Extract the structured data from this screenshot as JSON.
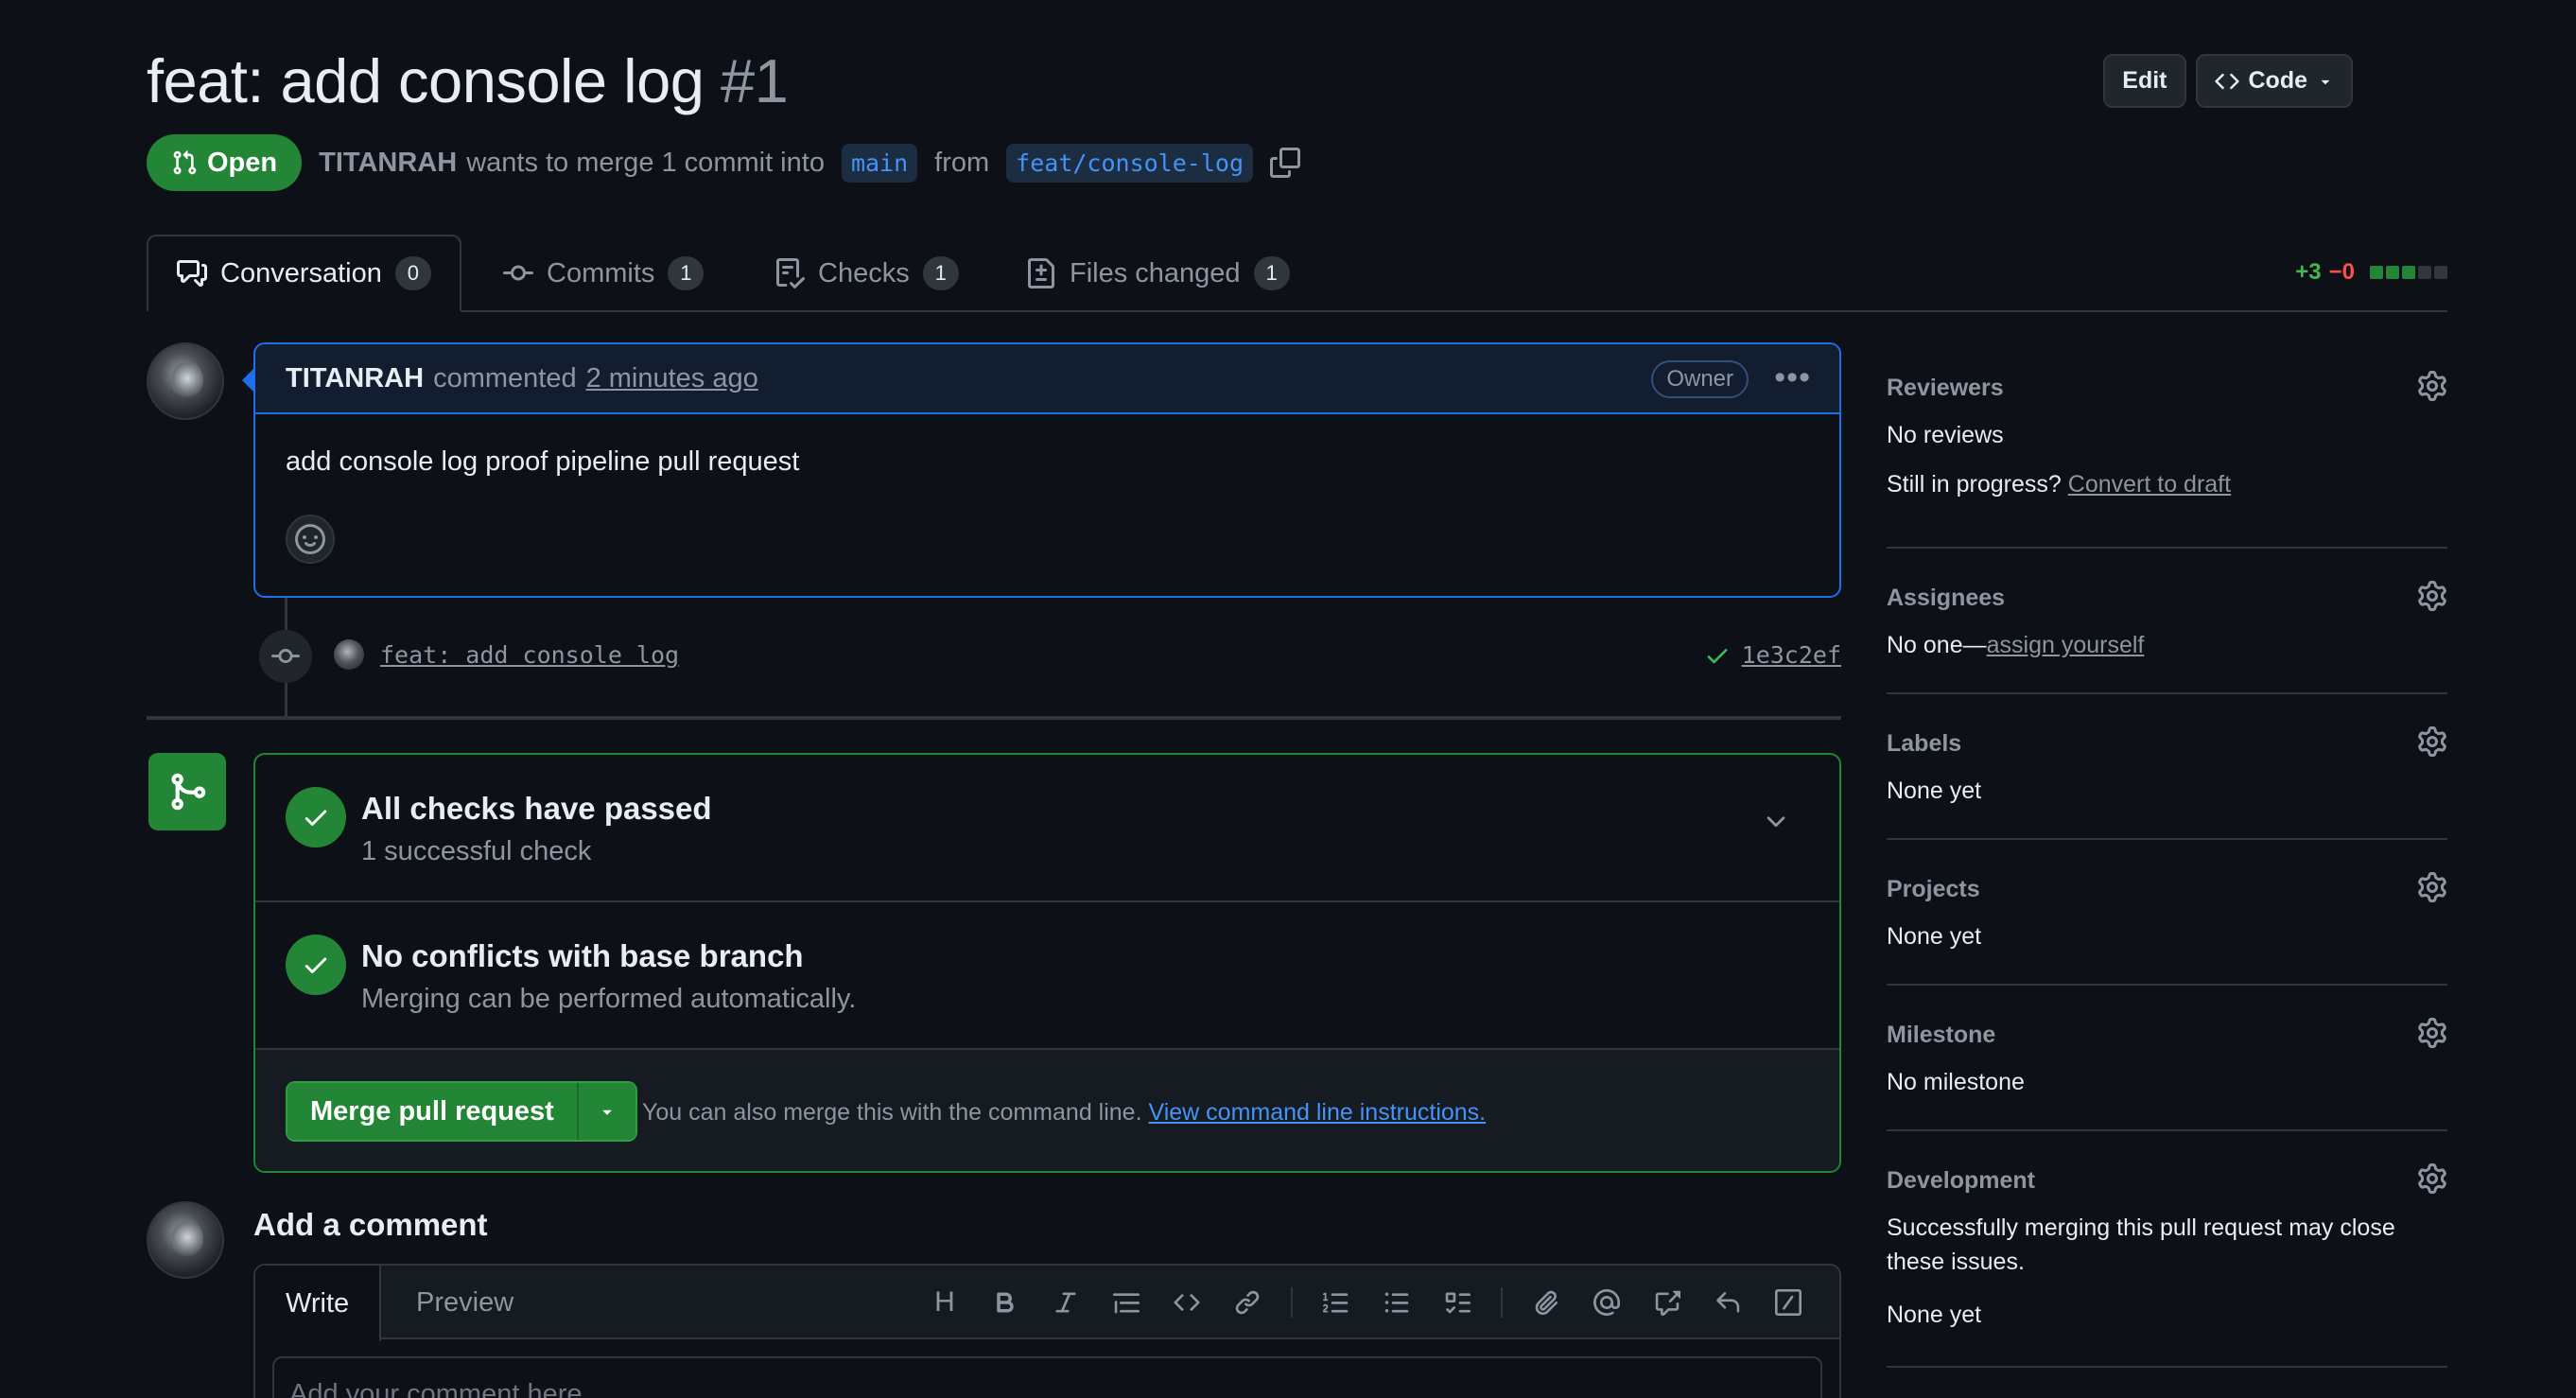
{
  "pr": {
    "title": "feat: add console log",
    "number": "#1",
    "state": "Open",
    "author": "TITANRAH",
    "merge_text_1": "wants to merge 1 commit into",
    "base_branch": "main",
    "merge_text_2": "from",
    "head_branch": "feat/console-log"
  },
  "header_buttons": {
    "edit": "Edit",
    "code": "Code"
  },
  "tabs": [
    {
      "label": "Conversation",
      "count": "0"
    },
    {
      "label": "Commits",
      "count": "1"
    },
    {
      "label": "Checks",
      "count": "1"
    },
    {
      "label": "Files changed",
      "count": "1"
    }
  ],
  "diffstat": {
    "additions": "+3",
    "deletions": "−0",
    "blocks_green": 3,
    "blocks_total": 5
  },
  "comment": {
    "author": "TITANRAH",
    "action": "commented",
    "time": "2 minutes ago",
    "role": "Owner",
    "body": "add console log proof pipeline pull request"
  },
  "commit": {
    "message": "feat: add console log",
    "sha": "1e3c2ef"
  },
  "merge_box": {
    "checks_title": "All checks have passed",
    "checks_sub": "1 successful check",
    "conflicts_title": "No conflicts with base branch",
    "conflicts_sub": "Merging can be performed automatically.",
    "merge_button": "Merge pull request",
    "hint": "You can also merge this with the command line.",
    "hint_link": "View command line instructions."
  },
  "add_comment": {
    "title": "Add a comment",
    "tab_write": "Write",
    "tab_preview": "Preview",
    "placeholder": "Add your comment here..."
  },
  "sidebar": {
    "reviewers": {
      "title": "Reviewers",
      "value": "No reviews",
      "progress_prefix": "Still in progress?",
      "progress_link": "Convert to draft"
    },
    "assignees": {
      "title": "Assignees",
      "value_prefix": "No one—",
      "value_link": "assign yourself"
    },
    "labels": {
      "title": "Labels",
      "value": "None yet"
    },
    "projects": {
      "title": "Projects",
      "value": "None yet"
    },
    "milestone": {
      "title": "Milestone",
      "value": "No milestone"
    },
    "development": {
      "title": "Development",
      "desc_line1": "Successfully merging this pull request may close",
      "desc_line2": "these issues.",
      "value": "None yet"
    }
  },
  "colors": {
    "accent_green": "#238636",
    "accent_blue": "#1f6feb",
    "link_blue": "#4493f8",
    "bg": "#0d1117"
  }
}
